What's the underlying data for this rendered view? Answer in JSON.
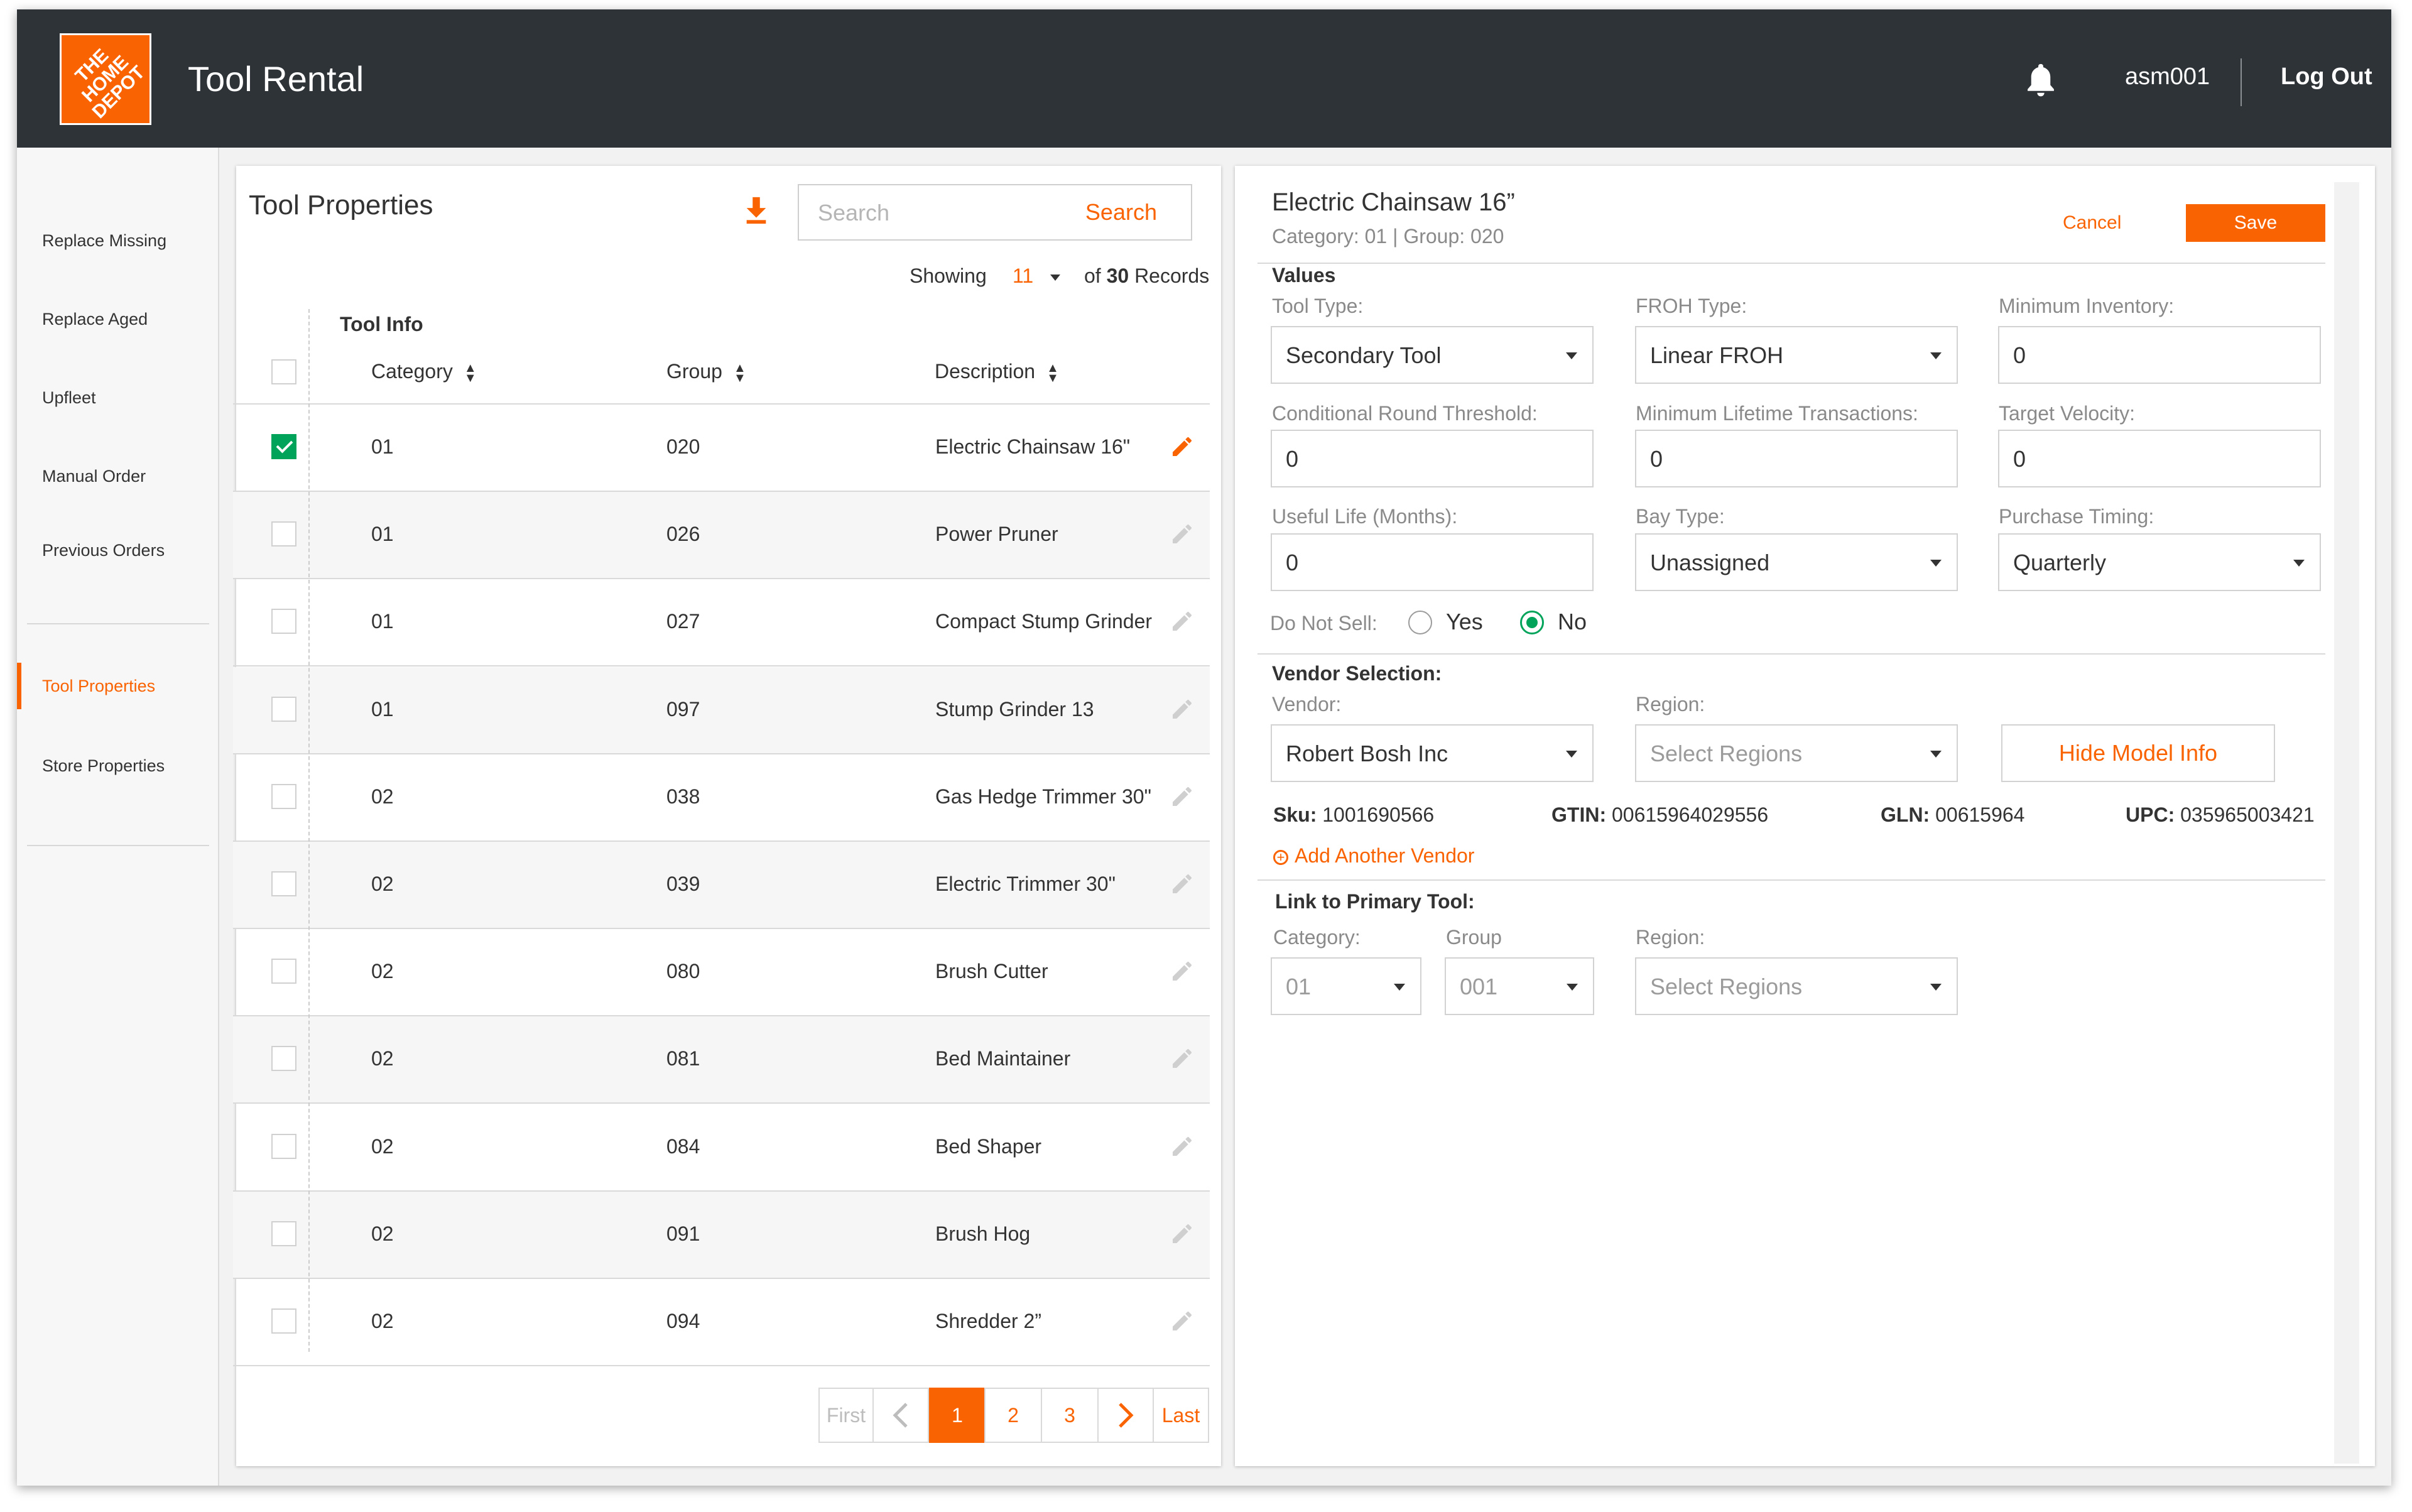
{
  "header": {
    "logo_text": "THE HOME DEPOT",
    "app_title": "Tool Rental",
    "username": "asm001",
    "logout_label": "Log Out"
  },
  "sidebar": {
    "items": [
      {
        "label": "Replace Missing"
      },
      {
        "label": "Replace Aged"
      },
      {
        "label": "Upfleet"
      },
      {
        "label": "Manual Order"
      },
      {
        "label": "Previous Orders"
      },
      {
        "label": "Tool Properties"
      },
      {
        "label": "Store Properties"
      }
    ],
    "active_label": "Tool Properties"
  },
  "list_panel": {
    "title": "Tool Properties",
    "download_icon": "download-icon",
    "search": {
      "placeholder": "Search",
      "value": "",
      "button_label": "Search"
    },
    "showing_label": "Showing",
    "page_size": "11",
    "records_of": "of",
    "records_total": "30",
    "records_label": "Records",
    "group_header": "Tool Info",
    "columns": [
      "Category",
      "Group",
      "Description"
    ],
    "rows": [
      {
        "category": "01",
        "group": "020",
        "description": "Electric Chainsaw 16\"",
        "checked": true
      },
      {
        "category": "01",
        "group": "026",
        "description": "Power Pruner",
        "checked": false
      },
      {
        "category": "01",
        "group": "027",
        "description": "Compact Stump Grinder",
        "checked": false
      },
      {
        "category": "01",
        "group": "097",
        "description": "Stump Grinder 13",
        "checked": false
      },
      {
        "category": "02",
        "group": "038",
        "description": "Gas Hedge Trimmer 30\"",
        "checked": false
      },
      {
        "category": "02",
        "group": "039",
        "description": "Electric Trimmer 30\"",
        "checked": false
      },
      {
        "category": "02",
        "group": "080",
        "description": "Brush Cutter",
        "checked": false
      },
      {
        "category": "02",
        "group": "081",
        "description": "Bed Maintainer",
        "checked": false
      },
      {
        "category": "02",
        "group": "084",
        "description": "Bed Shaper",
        "checked": false
      },
      {
        "category": "02",
        "group": "091",
        "description": "Brush Hog",
        "checked": false
      },
      {
        "category": "02",
        "group": "094",
        "description": "Shredder 2”",
        "checked": false
      }
    ],
    "pagination": {
      "first": "First",
      "pages": [
        "1",
        "2",
        "3"
      ],
      "current": "1",
      "last": "Last"
    }
  },
  "detail": {
    "title": "Electric Chainsaw 16”",
    "subtitle": "Category: 01 | Group: 020",
    "cancel_label": "Cancel",
    "save_label": "Save",
    "values_label": "Values",
    "tool_type": {
      "label": "Tool Type:",
      "value": "Secondary Tool"
    },
    "froh_type": {
      "label": "FROH Type:",
      "value": "Linear FROH"
    },
    "min_inventory": {
      "label": "Minimum Inventory:",
      "value": "0"
    },
    "cond_round_threshold": {
      "label": "Conditional Round Threshold:",
      "value": "0"
    },
    "min_lifetime_transactions": {
      "label": "Minimum Lifetime Transactions:",
      "value": "0"
    },
    "target_velocity": {
      "label": "Target Velocity:",
      "value": "0"
    },
    "useful_life": {
      "label": "Useful Life (Months):",
      "value": "0"
    },
    "bay_type": {
      "label": "Bay Type:",
      "value": "Unassigned"
    },
    "purchase_timing": {
      "label": "Purchase Timing:",
      "value": "Quarterly"
    },
    "do_not_sell": {
      "label": "Do Not Sell:",
      "yes_label": "Yes",
      "no_label": "No",
      "selected": "No"
    },
    "vendor_section": {
      "title": "Vendor Selection:",
      "vendor_label": "Vendor:",
      "vendor_value": "Robert Bosh Inc",
      "region_label": "Region:",
      "region_placeholder": "Select Regions",
      "hide_model_label": "Hide Model Info",
      "sku_label": "Sku:",
      "sku_value": "1001690566",
      "gtin_label": "GTIN:",
      "gtin_value": "00615964029556",
      "gln_label": "GLN:",
      "gln_value": "00615964",
      "upc_label": "UPC:",
      "upc_value": "035965003421",
      "add_vendor_label": "Add Another Vendor"
    },
    "link_primary": {
      "title": "Link to Primary Tool:",
      "category_label": "Category:",
      "category_value": "01",
      "group_label": "Group",
      "group_value": "001",
      "region_label": "Region:",
      "region_placeholder": "Select Regions"
    }
  },
  "colors": {
    "brand_orange": "#f96302",
    "header_bg": "#2e3338",
    "check_green": "#00a35a"
  }
}
